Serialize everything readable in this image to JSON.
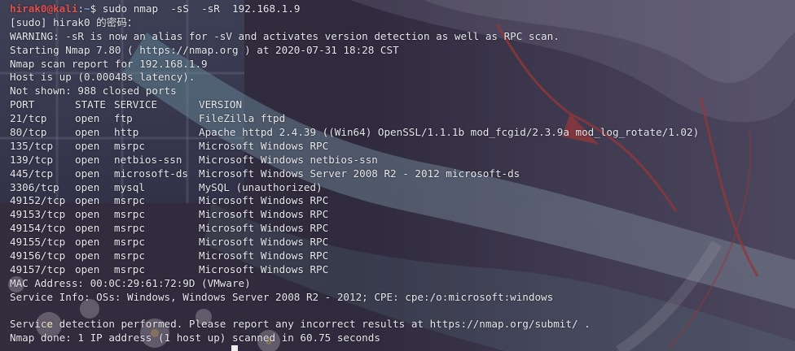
{
  "prompt": {
    "user": "hirak0",
    "at": "@",
    "host": "kali",
    "colon": ":",
    "path": "~",
    "dollar": "$",
    "command": " sudo nmap  -sS  -sR  192.168.1.9"
  },
  "lines_before_table": [
    "[sudo] hirak0 的密码：",
    "WARNING: -sR is now an alias for -sV and activates version detection as well as RPC scan.",
    "Starting Nmap 7.80 ( https://nmap.org ) at 2020-07-31 18:28 CST",
    "Nmap scan report for 192.168.1.9",
    "Host is up (0.00048s latency).",
    "Not shown: 988 closed ports"
  ],
  "table": {
    "headers": {
      "port": "PORT",
      "state": "STATE",
      "service": "SERVICE",
      "version": "VERSION"
    },
    "rows": [
      {
        "port": "21/tcp",
        "state": "open",
        "service": "ftp",
        "version": "FileZilla ftpd"
      },
      {
        "port": "80/tcp",
        "state": "open",
        "service": "http",
        "version": "Apache httpd 2.4.39 ((Win64) OpenSSL/1.1.1b mod_fcgid/2.3.9a mod_log_rotate/1.02)"
      },
      {
        "port": "135/tcp",
        "state": "open",
        "service": "msrpc",
        "version": "Microsoft Windows RPC"
      },
      {
        "port": "139/tcp",
        "state": "open",
        "service": "netbios-ssn",
        "version": "Microsoft Windows netbios-ssn"
      },
      {
        "port": "445/tcp",
        "state": "open",
        "service": "microsoft-ds",
        "version": "Microsoft Windows Server 2008 R2 - 2012 microsoft-ds"
      },
      {
        "port": "3306/tcp",
        "state": "open",
        "service": "mysql",
        "version": "MySQL (unauthorized)"
      },
      {
        "port": "49152/tcp",
        "state": "open",
        "service": "msrpc",
        "version": "Microsoft Windows RPC"
      },
      {
        "port": "49153/tcp",
        "state": "open",
        "service": "msrpc",
        "version": "Microsoft Windows RPC"
      },
      {
        "port": "49154/tcp",
        "state": "open",
        "service": "msrpc",
        "version": "Microsoft Windows RPC"
      },
      {
        "port": "49155/tcp",
        "state": "open",
        "service": "msrpc",
        "version": "Microsoft Windows RPC"
      },
      {
        "port": "49156/tcp",
        "state": "open",
        "service": "msrpc",
        "version": "Microsoft Windows RPC"
      },
      {
        "port": "49157/tcp",
        "state": "open",
        "service": "msrpc",
        "version": "Microsoft Windows RPC"
      }
    ]
  },
  "mac_line": "MAC Address: 00:0C:29:61:72:9D (VMware)",
  "service_info": "Service Info: OSs: Windows, Windows Server 2008 R2 - 2012; CPE: cpe:/o:microsoft:windows",
  "footer": {
    "detection": "Service detection performed. Please report any incorrect results at https://nmap.org/submit/ .",
    "done": "Nmap done: 1 IP address (1 host up) scanned in 60.75 seconds"
  },
  "colors": {
    "user": "#e0504f",
    "path": "#6f9ee8",
    "text": "#e6e6ec",
    "background": "#2c2a3a"
  }
}
